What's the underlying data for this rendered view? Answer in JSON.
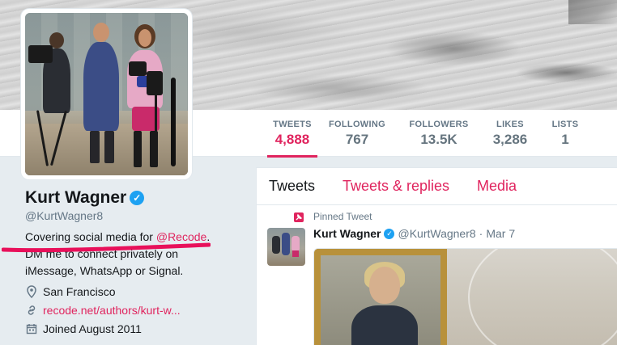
{
  "profile": {
    "name": "Kurt Wagner",
    "handle": "@KurtWagner8",
    "bio_prefix": "Covering social media for ",
    "bio_link": "@Recode",
    "bio_suffix": ". DM me to connect privately on iMessage, WhatsApp or Signal.",
    "location": "San Francisco",
    "website": "recode.net/authors/kurt-w...",
    "joined": "Joined August 2011"
  },
  "stats": [
    {
      "label": "TWEETS",
      "value": "4,888"
    },
    {
      "label": "FOLLOWING",
      "value": "767"
    },
    {
      "label": "FOLLOWERS",
      "value": "13.5K"
    },
    {
      "label": "LIKES",
      "value": "3,286"
    },
    {
      "label": "LISTS",
      "value": "1"
    }
  ],
  "tabs": [
    "Tweets",
    "Tweets & replies",
    "Media"
  ],
  "pinned_tweet": {
    "label": "Pinned Tweet",
    "name": "Kurt Wagner",
    "handle": "@KurtWagner8",
    "separator": "·",
    "date": "Mar 7"
  },
  "colors": {
    "accent": "#e0245e",
    "verified": "#1da1f2"
  },
  "icons": {
    "verified": "check-badge-icon",
    "location": "map-pin-icon",
    "link": "link-icon",
    "calendar": "calendar-icon",
    "pin": "pin-icon"
  }
}
